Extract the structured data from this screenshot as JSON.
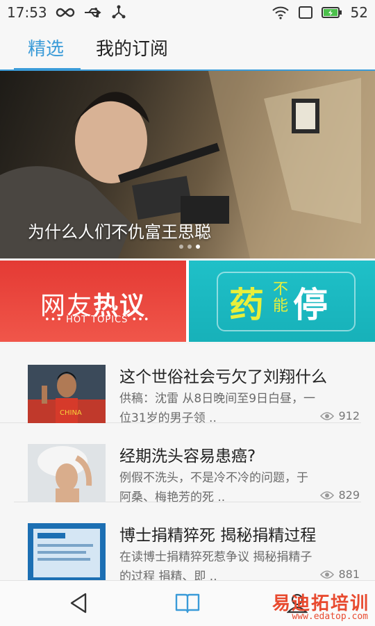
{
  "status_bar": {
    "time": "17:53",
    "battery": "52",
    "icons_left": [
      "infinity-icon",
      "usb-icon",
      "share-network-icon"
    ],
    "icons_right": [
      "wifi-icon",
      "sim-icon",
      "battery-charging-icon"
    ]
  },
  "tabs": [
    {
      "label": "精选",
      "active": true
    },
    {
      "label": "我的订阅",
      "active": false
    }
  ],
  "hero": {
    "caption": "为什么人们不仇富王思聪",
    "dots": 3,
    "active_dot": 2
  },
  "banners": {
    "left": {
      "main_pre": "网友",
      "main_bold": "热议",
      "sub": "••• HOT TOPICS •••"
    },
    "right": {
      "big1": "药",
      "small": "不能",
      "big2": "停"
    }
  },
  "news": [
    {
      "title": "这个世俗社会亏欠了刘翔什么",
      "desc_line1": "供稿：沈雷 从8日晚间至9日白昼，一",
      "desc_line2": "位31岁的男子领 ..",
      "views": "912"
    },
    {
      "title": "经期洗头容易患癌?",
      "desc_line1": "例假不洗头，不是冷不冷的问题，于",
      "desc_line2": "阿桑、梅艳芳的死 ..",
      "views": "829"
    },
    {
      "title": "博士捐精猝死 揭秘捐精过程",
      "desc_line1": "在读博士捐精猝死惹争议 揭秘捐精子",
      "desc_line2": "的过程 捐精、即 ..",
      "views": "881"
    }
  ],
  "bottom_nav": [
    "back-icon",
    "book-icon",
    "profile-icon"
  ],
  "watermark": {
    "text": "易迪拓培训",
    "url": "www.edatop.com"
  },
  "colors": {
    "accent": "#3a9bd8",
    "banner_red": "#e43a34",
    "banner_teal": "#1fc0c8"
  }
}
